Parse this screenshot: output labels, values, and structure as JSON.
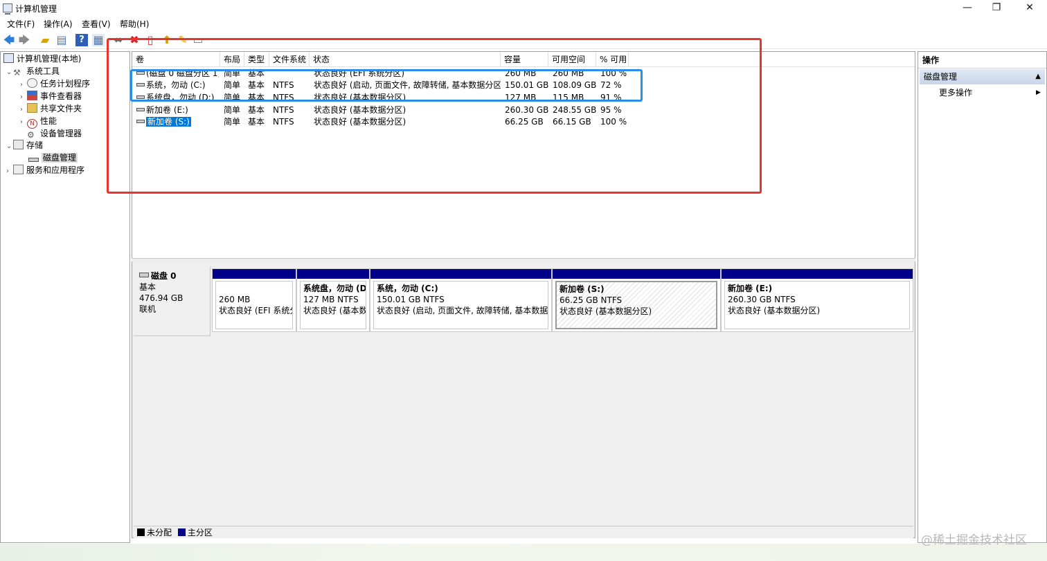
{
  "window": {
    "title": "计算机管理",
    "minimize_glyph": "—",
    "maximize_glyph": "❐",
    "close_glyph": "✕"
  },
  "menu": [
    "文件(F)",
    "操作(A)",
    "查看(V)",
    "帮助(H)"
  ],
  "toolbar": {
    "icons": [
      "back-arrow-icon",
      "forward-arrow-icon",
      "up-folder-icon",
      "show-hide-tree-icon",
      "help-icon",
      "properties-icon",
      "connect-icon",
      "delete-icon",
      "document-icon",
      "export-icon",
      "refresh-icon",
      "view-icon"
    ]
  },
  "tree": {
    "root": "计算机管理(本地)",
    "system_tools": "系统工具",
    "task_scheduler": "任务计划程序",
    "event_viewer": "事件查看器",
    "shared_folders": "共享文件夹",
    "performance": "性能",
    "device_manager": "设备管理器",
    "storage": "存储",
    "disk_management": "磁盘管理",
    "services": "服务和应用程序"
  },
  "volumes": {
    "columns": [
      "卷",
      "布局",
      "类型",
      "文件系统",
      "状态",
      "容量",
      "可用空间",
      "% 可用"
    ],
    "rows": [
      [
        "(磁盘 0 磁盘分区 1)",
        "简单",
        "基本",
        "",
        "状态良好 (EFI 系统分区)",
        "260 MB",
        "260 MB",
        "100 %"
      ],
      [
        "系统，勿动 (C:)",
        "简单",
        "基本",
        "NTFS",
        "状态良好 (启动, 页面文件, 故障转储, 基本数据分区)",
        "150.01 GB",
        "108.09 GB",
        "72 %"
      ],
      [
        "系统盘，勿动 (D:)",
        "简单",
        "基本",
        "NTFS",
        "状态良好 (基本数据分区)",
        "127 MB",
        "115 MB",
        "91 %"
      ],
      [
        "新加卷 (E:)",
        "简单",
        "基本",
        "NTFS",
        "状态良好 (基本数据分区)",
        "260.30 GB",
        "248.55 GB",
        "95 %"
      ],
      [
        "新加卷 (S:)",
        "简单",
        "基本",
        "NTFS",
        "状态良好 (基本数据分区)",
        "66.25 GB",
        "66.15 GB",
        "100 %"
      ]
    ]
  },
  "disk": {
    "name": "磁盘 0",
    "type": "基本",
    "size": "476.94 GB",
    "status": "联机",
    "partitions": [
      {
        "name": "",
        "size": "260 MB",
        "status": "状态良好 (EFI 系统分区)"
      },
      {
        "name": "系统盘，勿动 (D",
        "size": "127 MB NTFS",
        "status": "状态良好 (基本数据分区)"
      },
      {
        "name": "系统，勿动 (C:)",
        "size": "150.01 GB NTFS",
        "status": "状态良好 (启动, 页面文件, 故障转储, 基本数据分区)"
      },
      {
        "name": "新加卷 (S:)",
        "size": "66.25 GB NTFS",
        "status": "状态良好 (基本数据分区)"
      },
      {
        "name": "新加卷 (E:)",
        "size": "260.30 GB NTFS",
        "status": "状态良好 (基本数据分区)"
      }
    ]
  },
  "legend": {
    "unallocated": "未分配",
    "primary": "主分区",
    "unallocated_color": "#000000",
    "primary_color": "#00008b"
  },
  "actions": {
    "header": "操作",
    "section": "磁盘管理",
    "more": "更多操作"
  },
  "watermark": "@稀土掘金技术社区",
  "colors": {
    "selection": "#0078d7",
    "annotation_red": "#e8332f",
    "annotation_blue": "#2a8ee8"
  }
}
